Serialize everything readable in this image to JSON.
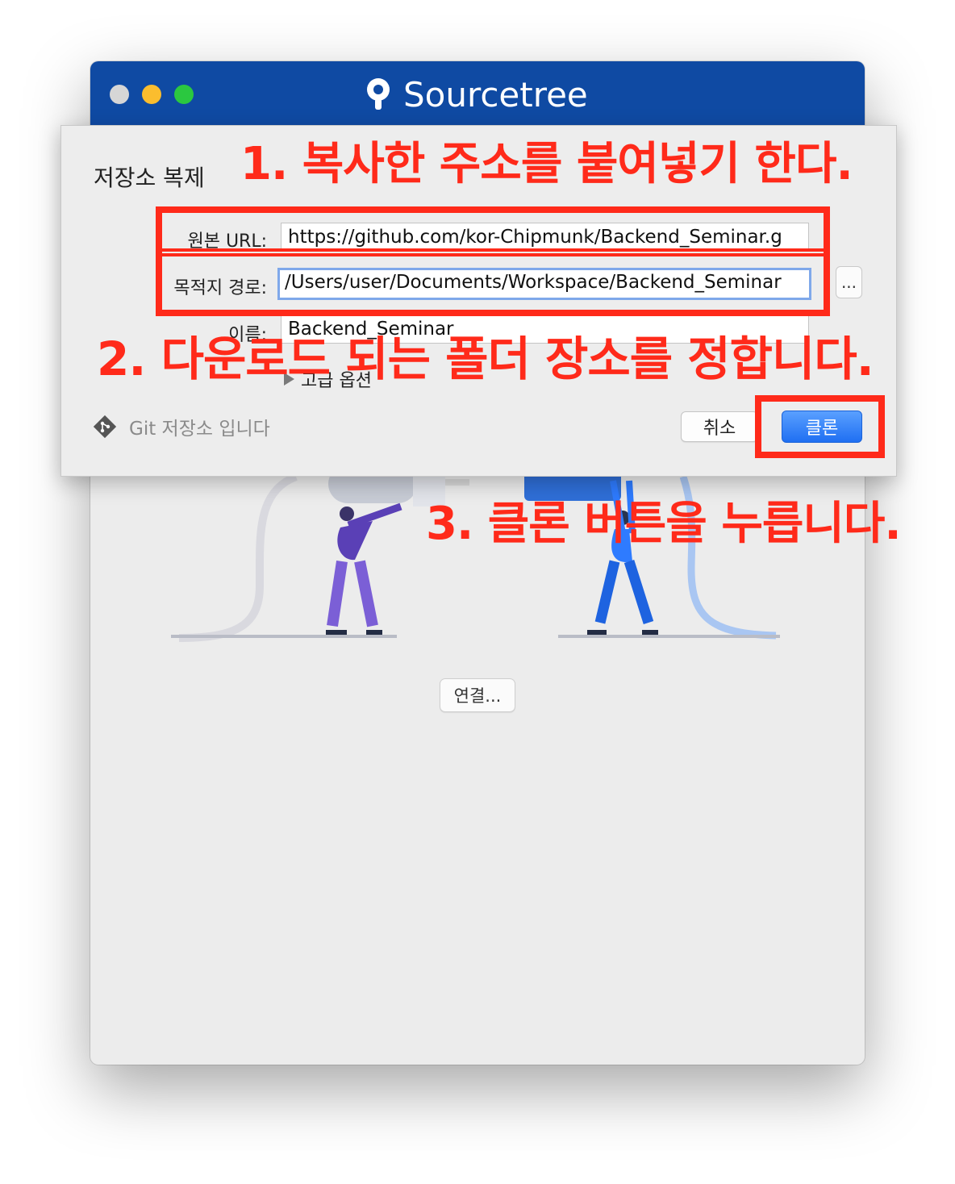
{
  "window": {
    "app_title": "Sourcetree"
  },
  "main": {
    "connect_label": "연결..."
  },
  "dialog": {
    "title": "저장소 복제",
    "source_url": {
      "label": "원본 URL:",
      "value": "https://github.com/kor-Chipmunk/Backend_Seminar.g"
    },
    "destination": {
      "label": "목적지 경로:",
      "value": "/Users/user/Documents/Workspace/Backend_Seminar"
    },
    "browse_label": "...",
    "name": {
      "label": "이름:",
      "value": "Backend_Seminar"
    },
    "advanced_label": "고급 옵션",
    "repo_type_label": "Git 저장소 입니다",
    "cancel_label": "취소",
    "clone_label": "클론"
  },
  "annotations": {
    "step1": "1. 복사한 주소를 붙여넣기 한다.",
    "step2": "2. 다운로드 되는 폴더 장소를 정합니다.",
    "step3": "3. 클론 버튼을 누릅니다.",
    "color": "#ff2a1a"
  },
  "colors": {
    "titlebar": "#0f4aa3",
    "accent": "#1f6ff2"
  },
  "icons": [
    "sourcetree-logo-icon",
    "git-diamond-icon",
    "disclosure-triangle-icon"
  ]
}
